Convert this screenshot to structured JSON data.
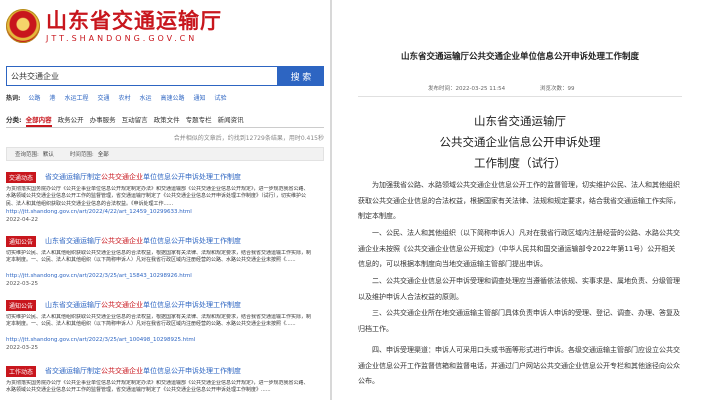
{
  "site": {
    "title": "山东省交通运输厅",
    "url": "JTT.SHANDONG.GOV.CN"
  },
  "search": {
    "value": "公共交通企业",
    "button_label": "搜 索"
  },
  "hot_words": {
    "label": "热词:",
    "items": [
      "公路",
      "港",
      "水运工程",
      "交通",
      "农村",
      "水运",
      "高速公路",
      "通知",
      "试验"
    ]
  },
  "categories": {
    "label": "分类:",
    "items": [
      "全部内容",
      "政务公开",
      "办事服务",
      "互动留言",
      "政策文件",
      "专题专栏",
      "新闻资讯"
    ],
    "active_index": 0
  },
  "result_count": "合并相似的文章后，约找到12729条结果，用时0.415秒",
  "filters": {
    "sort_label": "查询范围:",
    "sort_value": "默认",
    "time_label": "时间范围:",
    "time_value": "全部"
  },
  "results": [
    {
      "tag": "交通动态",
      "title_pre": "省交通运输厅制定",
      "title_hl": "公共交通企业",
      "title_post": "单位信息公开申诉处理工作制度",
      "desc": "为贯彻落实国务院办公厅《公共企事业单位信息公开规定制定办法》和交通运输部《公共交通企业信息公开规定》，进一步规范我省公路、水路领域公共交通企业信息公开工作的监督管理，省交通运输厅制定了《公共交通企业信息公开申诉处理工作制度》（试行），切实维护公民、法人和其他组织获取公共交通企业信息的合法权益。《申诉处理工作......",
      "url": "http://jtt.shandong.gov.cn/art/2022/4/22/art_12459_10299633.html",
      "date": "2022-04-22"
    },
    {
      "tag": "通知公告",
      "title_pre": "山东省交通运输厅",
      "title_hl": "公共交通企业",
      "title_post": "单位信息公开申诉处理工作制度",
      "desc": "切实维护公民、法人和其他组织获取公共交通企业信息的合法权益，根据国家有关法律、法规和规定要求，结合我省交通运输工作实际，制定本制度。一、公民、法人和其他组织（以下简称申诉人）凡对在我省行政区域内注册经营的公路、水路公共交通企业未按照《......",
      "url": "http://jtt.shandong.gov.cn/art/2022/3/25/art_15843_10298926.html",
      "date": "2022-03-25"
    },
    {
      "tag": "通知公告",
      "title_pre": "山东省交通运输厅",
      "title_hl": "公共交通企业",
      "title_post": "单位信息公开申诉处理工作制度",
      "desc": "切实维护公民、法人和其他组织获取公共交通企业信息的合法权益，根据国家有关法律、法规和规定要求，结合我省交通运输工作实际，制定本制度。一、公民、法人和其他组织（以下简称申诉人）凡对在我省行政区域内注册经营的公路、水路公共交通企业未按照《......",
      "url": "http://jtt.shandong.gov.cn/art/2022/3/25/art_100498_10298925.html",
      "date": "2022-03-25"
    },
    {
      "tag": "工作动态",
      "title_pre": "省交通运输厅制定",
      "title_hl": "公共交通企业",
      "title_post": "单位信息公开申诉处理工作制度",
      "desc": "为贯彻落实国务院办公厅《公共企事业单位信息公开规定制定办法》和交通运输部《公共交通企业信息公开规定》，进一步规范我省公路、水路领域公共交通企业信息公开工作的监督管理，省交通运输厅制定了《公共交通企业信息公开申诉处理工作制度》......",
      "url": "",
      "date": ""
    }
  ],
  "article": {
    "title": "山东省交通运输厅公共交通企业单位信息公开申诉处理工作制度",
    "date_label": "发布时间：2022-03-25 11:54",
    "views_label": "浏览次数：99",
    "doc_title_lines": [
      "山东省交通运输厅",
      "公共交通企业信息公开申诉处理",
      "工作制度（试行）"
    ],
    "paragraphs": [
      "为加强我省公路、水路领域公共交通企业信息公开工作的监督管理，切实维护公民、法人和其他组织获取公共交通企业信息的合法权益，根据国家有关法律、法规和规定要求，结合我省交通运输工作实际，制定本制度。",
      "一、公民、法人和其他组织（以下简称申诉人）凡对在我省行政区域内注册经营的公路、水路公共交通企业未按照《公共交通企业信息公开规定》（中华人民共和国交通运输部令2022年第11号）公开相关信息的，可以根据本制度向当地交通运输主管部门提出申诉。",
      "二、公共交通企业信息公开申诉受理和调查处理应当遵循依法依规、实事求是、属地负责、分级管理以及维护申诉人合法权益的原则。",
      "三、公共交通企业所在地交通运输主管部门具体负责申诉人申诉的受理、登记、调查、办理、答复及归档工作。",
      "四、申诉受理渠道：申诉人可采用口头或书面等形式进行申诉。各级交通运输主管部门应设立公共交通企业信息公开工作监督信箱和监督电话，并通过门户网站公共交通企业信息公开专栏和其他途径向公众公布。"
    ]
  }
}
